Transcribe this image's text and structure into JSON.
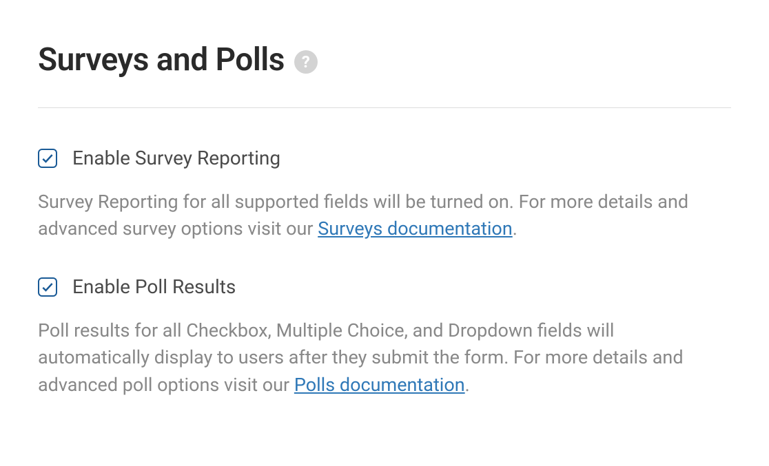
{
  "heading": "Surveys and Polls",
  "options": {
    "survey": {
      "label": "Enable Survey Reporting",
      "desc_before": "Survey Reporting for all supported fields will be turned on. For more details and advanced survey options visit our ",
      "link_text": "Surveys documentation",
      "desc_after": "."
    },
    "poll": {
      "label": "Enable Poll Results",
      "desc_before": "Poll results for all Checkbox, Multiple Choice, and Dropdown fields will automatically display to users after they submit the form. For more details and advanced poll options visit our ",
      "link_text": "Polls documentation",
      "desc_after": "."
    }
  }
}
